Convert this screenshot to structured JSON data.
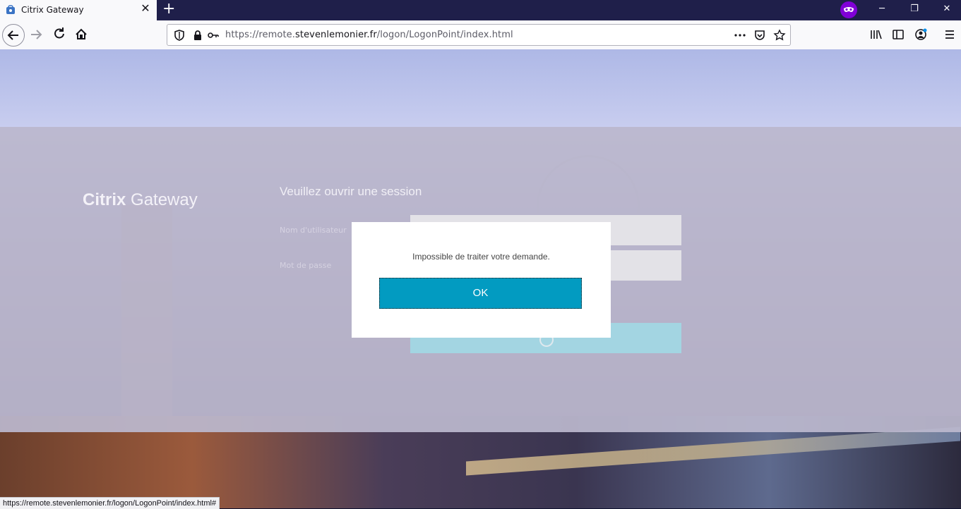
{
  "browser": {
    "tab_title": "Citrix Gateway",
    "url_prefix": "https://remote.",
    "url_domain": "stevenlemonier.fr",
    "url_path": "/logon/LogonPoint/index.html",
    "status_url": "https://remote.stevenlemonier.fr/logon/LogonPoint/index.html#"
  },
  "page": {
    "brand_bold": "Citrix",
    "brand_light": " Gateway",
    "heading": "Veuillez ouvrir une session",
    "username_label": "Nom d'utilisateur",
    "password_label": "Mot de passe"
  },
  "dialog": {
    "message": "Impossible de traiter votre demande.",
    "ok_label": "OK"
  },
  "colors": {
    "ok_button": "#029bc1",
    "private_badge": "#8000d7",
    "tabbar": "#1f1f4a"
  }
}
